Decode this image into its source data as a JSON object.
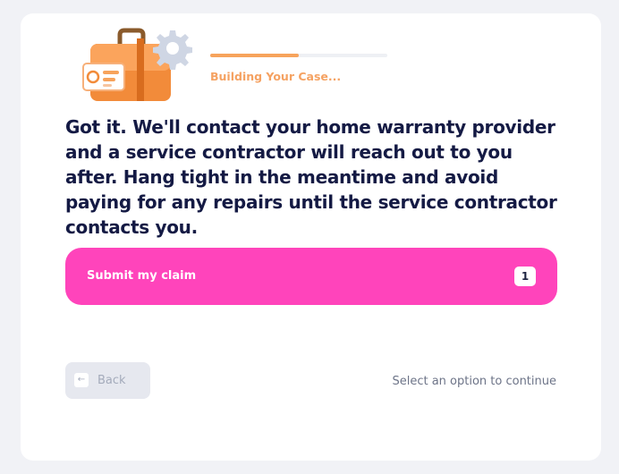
{
  "header": {
    "status_text": "Building Your Case...",
    "progress_fraction": 0.5
  },
  "question": {
    "text": "Got it. We'll contact your home warranty provider and a service contractor will reach out to you after. Hang tight in the meantime and avoid paying for any repairs until the service contractor contacts you."
  },
  "options": [
    {
      "label": "Submit my claim",
      "key": "1"
    }
  ],
  "footer": {
    "back_key": "←",
    "back_label": "Back",
    "hint": "Select an option to continue"
  },
  "colors": {
    "accent_orange": "#f7a35c",
    "option_pink": "#ff44bb",
    "heading_navy": "#141a44"
  },
  "icons": [
    "briefcase-icon",
    "gear-icon",
    "id-card-icon",
    "arrow-left-icon"
  ]
}
